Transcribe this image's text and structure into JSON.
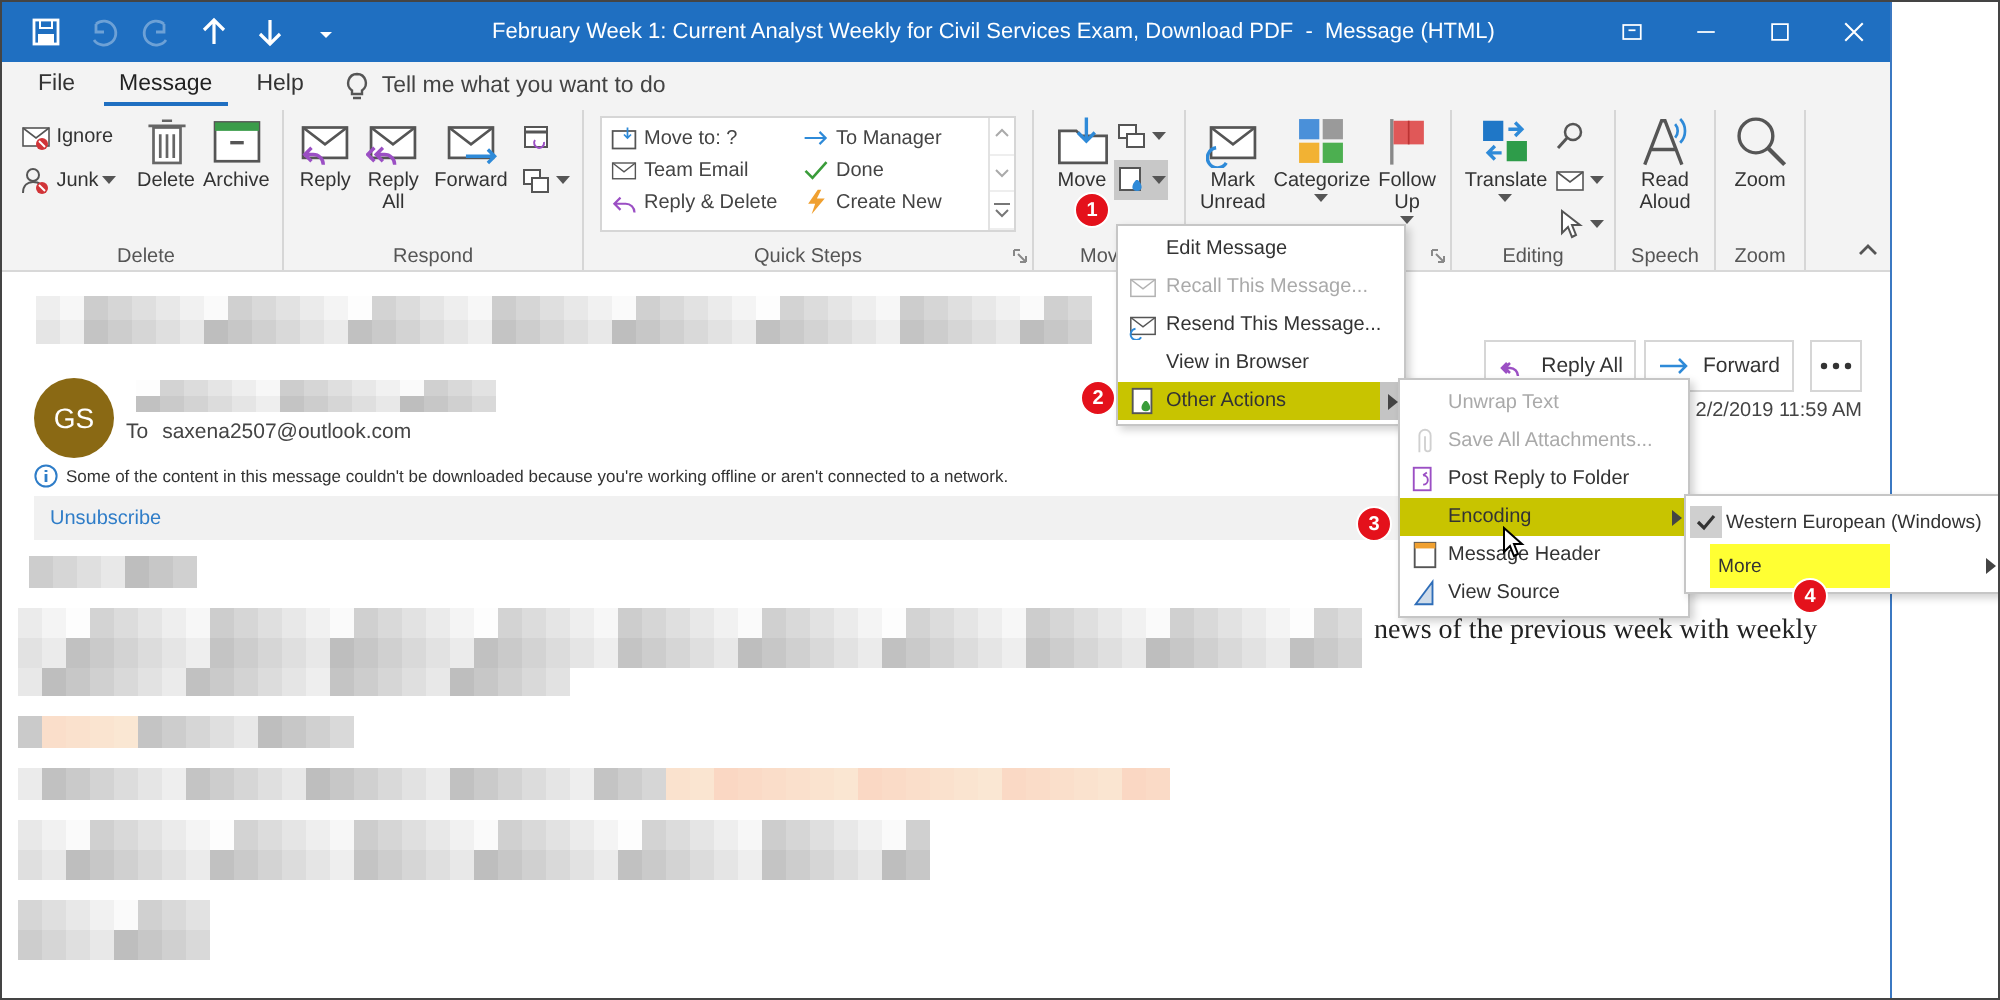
{
  "window": {
    "title": "February Week 1: Current Analyst Weekly for Civil Services Exam, Download PDF  -  Message (HTML)"
  },
  "quick_access": [
    {
      "disabled": false
    },
    {
      "disabled": true
    },
    {
      "disabled": true
    },
    {
      "disabled": false
    },
    {
      "disabled": false
    },
    {
      "disabled": false
    }
  ],
  "tabs": [
    {
      "label": "File",
      "selected": false
    },
    {
      "label": "Message",
      "selected": true
    },
    {
      "label": "Help",
      "selected": false
    }
  ],
  "tell_me": {
    "placeholder": "Tell me what you want to do"
  },
  "ribbon": [
    {
      "label": "Delete",
      "launcher": false,
      "items": [
        {
          "kind": "stack",
          "items": [
            {
              "label": "Ignore",
              "dropdown": false
            },
            {
              "label": "Junk",
              "dropdown": true
            }
          ]
        },
        {
          "kind": "large",
          "label": "Delete",
          "dropdown": false
        },
        {
          "kind": "large",
          "label": "Archive",
          "dropdown": false
        }
      ]
    },
    {
      "label": "Respond",
      "launcher": false,
      "items": [
        {
          "kind": "large",
          "label": "Reply",
          "dropdown": false
        },
        {
          "kind": "large",
          "label": "Reply All",
          "dropdown": false
        },
        {
          "kind": "large",
          "label": "Forward",
          "dropdown": false
        },
        {
          "kind": "stack",
          "items": [
            {
              "dropdown": false
            },
            {
              "dropdown": true
            }
          ]
        }
      ]
    },
    {
      "label": "Quick Steps",
      "launcher": true,
      "items": [
        {
          "kind": "gallery",
          "items": [
            {
              "label": "Move to: ?"
            },
            {
              "label": "To Manager"
            },
            {
              "label": "Team Email"
            },
            {
              "label": "Done"
            },
            {
              "label": "Reply & Delete"
            },
            {
              "label": "Create New"
            }
          ]
        }
      ]
    },
    {
      "label": "Mov",
      "launcher": false,
      "items": [
        {
          "kind": "large",
          "label": "Move"
        },
        {
          "kind": "stack",
          "items": [
            {
              "dropdown": true,
              "selected": false
            },
            {
              "dropdown": true,
              "selected": true
            }
          ]
        }
      ]
    },
    {
      "launcher": true,
      "items": [
        {
          "kind": "large",
          "label": "Mark Unread"
        },
        {
          "kind": "large",
          "label": "Categorize",
          "dropdown": true
        },
        {
          "kind": "large",
          "label": "Follow Up",
          "dropdown": true
        }
      ]
    },
    {
      "label": "Editing",
      "launcher": false,
      "items": [
        {
          "kind": "large",
          "label": "Translate",
          "dropdown": true
        },
        {
          "kind": "stack",
          "items": [
            {
              "dropdown": false
            },
            {
              "dropdown": true
            },
            {
              "dropdown": true
            }
          ]
        }
      ]
    },
    {
      "label": "Speech",
      "launcher": false,
      "items": [
        {
          "kind": "large",
          "label": "Read Aloud",
          "dropdown": false
        }
      ]
    },
    {
      "label": "Zoom",
      "launcher": false,
      "items": [
        {
          "kind": "large",
          "label": "Zoom",
          "dropdown": false
        }
      ]
    }
  ],
  "message": {
    "initials": "GS",
    "to_label": "To",
    "to": "saxena2507@outlook.com",
    "actions": [
      {
        "label": "Reply All"
      },
      {
        "label": "Forward"
      }
    ],
    "date": "2/2/2019 11:59 AM",
    "notice": "Some of the content in this message couldn't be downloaded because you're working offline or aren't connected to a network.",
    "unsubscribe": "Unsubscribe",
    "body_text": "news of the previous week with weekly"
  },
  "menus": [
    {
      "items": [
        {
          "label": "Edit Message",
          "icon": false,
          "disabled": false,
          "selected": false,
          "submenu": false
        },
        {
          "label": "Recall This Message...",
          "icon": true,
          "disabled": true,
          "selected": false,
          "submenu": false
        },
        {
          "label": "Resend This Message...",
          "icon": true,
          "disabled": false,
          "selected": false,
          "submenu": false
        },
        {
          "label": "View in Browser",
          "icon": false,
          "disabled": false,
          "selected": false,
          "submenu": false
        },
        {
          "label": "Other Actions",
          "icon": true,
          "disabled": false,
          "selected": true,
          "submenu": true
        }
      ]
    },
    {
      "items": [
        {
          "label": "Unwrap Text",
          "icon": false,
          "disabled": true,
          "selected": false,
          "submenu": false
        },
        {
          "label": "Save All Attachments...",
          "icon": true,
          "disabled": true,
          "selected": false,
          "submenu": false
        },
        {
          "label": "Post Reply to Folder",
          "icon": true,
          "disabled": false,
          "selected": false,
          "submenu": false
        },
        {
          "label": "Encoding",
          "icon": false,
          "disabled": false,
          "selected": true,
          "submenu": true
        },
        {
          "label": "Message Header",
          "icon": true,
          "disabled": false,
          "selected": false,
          "submenu": false
        },
        {
          "label": "View Source",
          "icon": true,
          "disabled": false,
          "selected": false,
          "submenu": false
        }
      ]
    },
    {
      "items": [
        {
          "label": "Western European (Windows)",
          "checked": true,
          "selected": false,
          "submenu": false
        },
        {
          "label": "More",
          "checked": false,
          "selected": true,
          "submenu": true
        }
      ]
    }
  ],
  "callouts": [
    "1",
    "2",
    "3",
    "4"
  ]
}
